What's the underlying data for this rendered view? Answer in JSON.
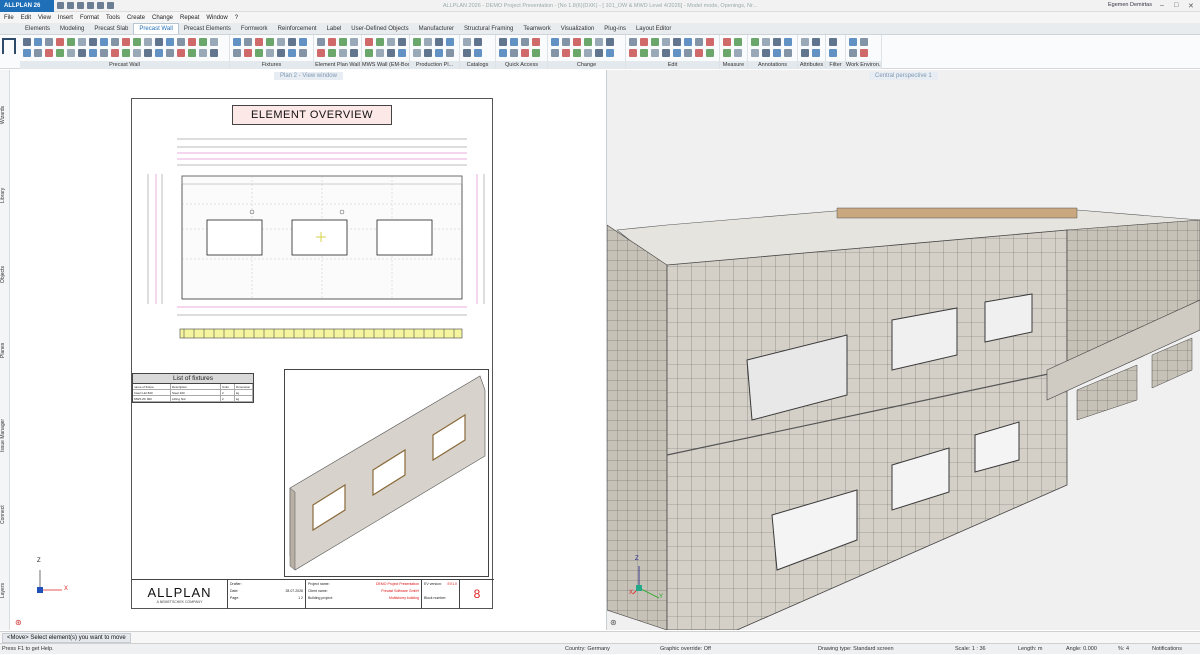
{
  "app": {
    "badge": "ALLPLAN 26",
    "title": "ALLPLAN 2026 - DEMO Project Presentation - [No 1.8(6)(DXK) - [ 101_OW & MWD Level 4/2026] - Model mode, Openings, Nr...",
    "user": "Egemen Demirtas"
  },
  "menu": [
    "File",
    "Edit",
    "View",
    "Insert",
    "Format",
    "Tools",
    "Create",
    "Change",
    "Repeat",
    "Window",
    "?"
  ],
  "tabs": [
    "Elements",
    "Modeling",
    "Precast Slab",
    "Precast Wall",
    "Precast Elements",
    "Formwork",
    "Reinforcement",
    "Label",
    "User-Defined Objects",
    "Manufacturer",
    "Structural Framing",
    "Teamwork",
    "Visualization",
    "Plug-ins",
    "Layout Editor"
  ],
  "active_tab": "Precast Wall",
  "ribbon_groups": [
    "Precast Wall",
    "Fixtures",
    "Element Plan Wall",
    "MWS Wall (EM-Boos...",
    "Production Pl...",
    "Catalogs",
    "Quick Access",
    "Change",
    "Edit",
    "Measure",
    "Annotations",
    "Attributes",
    "Filter",
    "Work Environ..."
  ],
  "left_tabs": [
    "Wizards",
    "Library",
    "Objects",
    "Planes",
    "Issue Manager",
    "Connect",
    "Layers"
  ],
  "left_view": {
    "title": "Plan 2 - View window",
    "sheet_title": "ELEMENT OVERVIEW",
    "fixtures": {
      "title": "List of fixtures",
      "headers": [
        "name of fixture",
        "Description",
        "Units",
        "Dimension"
      ],
      "rows": [
        [
          "Insert Hol 820",
          "Steel 200",
          "2",
          "kg"
        ],
        [
          "MWS ZK 900",
          "Lifting Nut",
          "2",
          "kg"
        ]
      ]
    },
    "title_block": {
      "logo": "ALLPLAN",
      "logo_sub": "A NEMETSCHEK COMPANY",
      "fields": [
        {
          "label": "Drafter:",
          "value": ""
        },
        {
          "label": "Date:",
          "value": "28.07.2026"
        },
        {
          "label": "Page:",
          "value": "1   2"
        }
      ],
      "project": [
        {
          "label": "Project name:",
          "value": "DEMO Project Presentation"
        },
        {
          "label": "Client name:",
          "value": "Precast Software GmbH"
        },
        {
          "label": "Building project:",
          "value": "Multistorey building"
        }
      ],
      "element_version_label": "EV version:",
      "element_version": "EV1.0",
      "block_number_label": "Block number:",
      "block_number": "8"
    },
    "axes": {
      "x": "X",
      "z": "Z"
    }
  },
  "right_view": {
    "title": "Central perspective 1",
    "axes": {
      "x": "X",
      "y": "Y",
      "z": "Z"
    }
  },
  "command_prompt": "<Move> Select element(s) you want to move",
  "status": {
    "help": "Press F1 to get Help.",
    "country": "Country:  Germany",
    "graphic": "Graphic override:  Off",
    "drawing_type": "Drawing type:  Standard screen",
    "scale": "Scale:  1 : 36",
    "length": "Length:  m",
    "angle": "Angle:  0.000",
    "percent": "%:  4",
    "notifications": "Notifications"
  },
  "colors": {
    "accent": "#1f6fb8",
    "title_pink": "#fde8e8",
    "red_text": "#d11"
  }
}
